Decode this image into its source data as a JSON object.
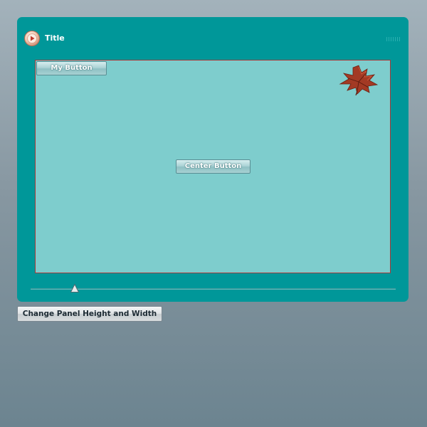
{
  "panel": {
    "title": "Title",
    "title_icon": "play-disc-icon",
    "grip_icon": "grip-icon",
    "background_color": "#009799"
  },
  "content": {
    "background_color": "#7ecdcd",
    "border_color": "#a53b3b",
    "my_button_label": "My Button",
    "center_button_label": "Center Button",
    "leaf_image": "maple-leaf-icon"
  },
  "slider": {
    "value_fraction": 0.12
  },
  "footer": {
    "change_button_label": "Change Panel Height and Width"
  }
}
